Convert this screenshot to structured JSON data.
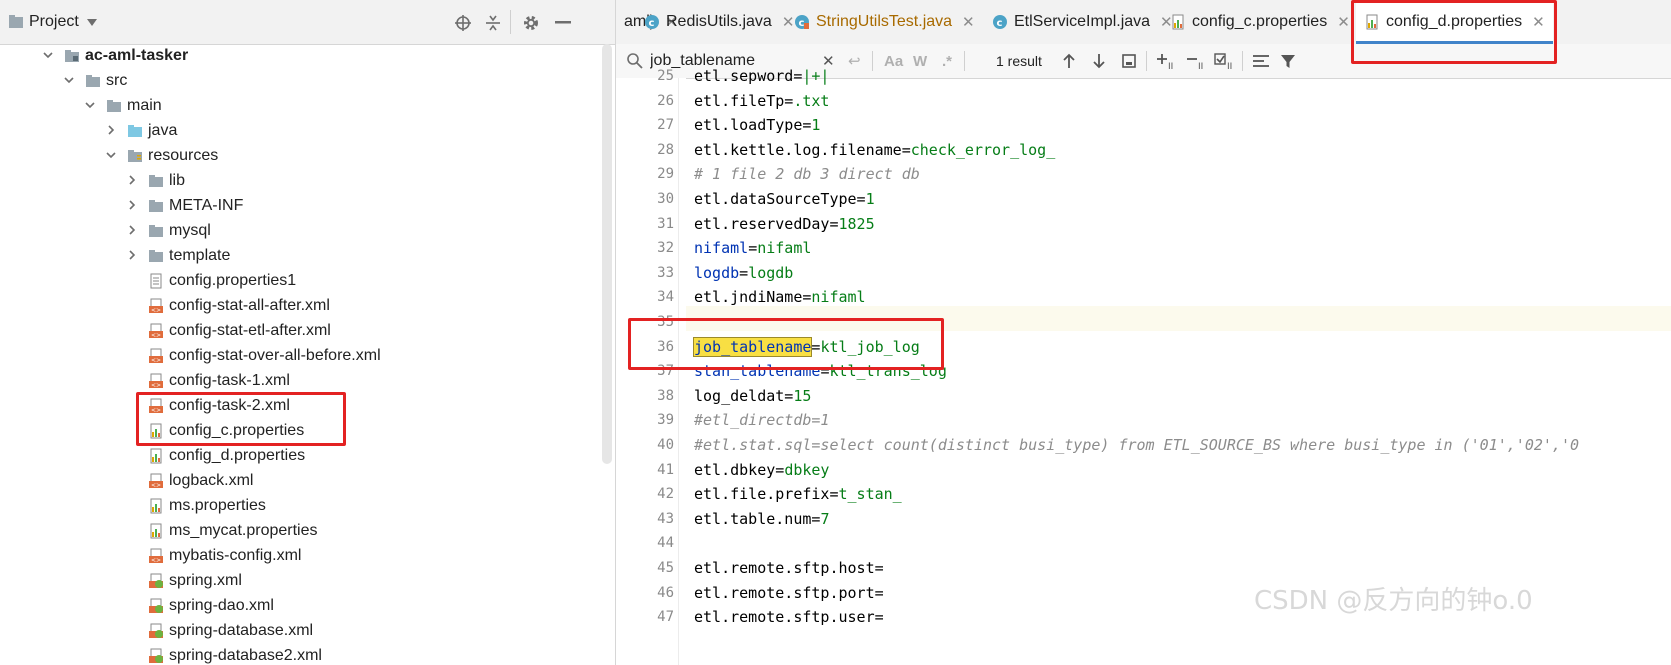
{
  "project": {
    "title": "Project",
    "tree": [
      {
        "label": "ac-aml-tasker",
        "type": "module",
        "depth": 0,
        "expanded": true,
        "bold": true
      },
      {
        "label": "src",
        "type": "folder",
        "depth": 1,
        "expanded": true
      },
      {
        "label": "main",
        "type": "folder",
        "depth": 2,
        "expanded": true
      },
      {
        "label": "java",
        "type": "src-folder",
        "depth": 3,
        "expanded": false
      },
      {
        "label": "resources",
        "type": "res-folder",
        "depth": 3,
        "expanded": true
      },
      {
        "label": "lib",
        "type": "folder",
        "depth": 4,
        "expanded": false
      },
      {
        "label": "META-INF",
        "type": "folder",
        "depth": 4,
        "expanded": false
      },
      {
        "label": "mysql",
        "type": "folder",
        "depth": 4,
        "expanded": false
      },
      {
        "label": "template",
        "type": "folder",
        "depth": 4,
        "expanded": false
      },
      {
        "label": "config.properties1",
        "type": "text-file",
        "depth": 4
      },
      {
        "label": "config-stat-all-after.xml",
        "type": "xml-file",
        "depth": 4
      },
      {
        "label": "config-stat-etl-after.xml",
        "type": "xml-file",
        "depth": 4
      },
      {
        "label": "config-stat-over-all-before.xml",
        "type": "xml-file",
        "depth": 4
      },
      {
        "label": "config-task-1.xml",
        "type": "xml-file",
        "depth": 4
      },
      {
        "label": "config-task-2.xml",
        "type": "xml-file",
        "depth": 4
      },
      {
        "label": "config_c.properties",
        "type": "properties-file",
        "depth": 4
      },
      {
        "label": "config_d.properties",
        "type": "properties-file",
        "depth": 4
      },
      {
        "label": "logback.xml",
        "type": "xml-file",
        "depth": 4
      },
      {
        "label": "ms.properties",
        "type": "properties-file",
        "depth": 4
      },
      {
        "label": "ms_mycat.properties",
        "type": "properties-file",
        "depth": 4
      },
      {
        "label": "mybatis-config.xml",
        "type": "xml-file",
        "depth": 4
      },
      {
        "label": "spring.xml",
        "type": "spring-file",
        "depth": 4
      },
      {
        "label": "spring-dao.xml",
        "type": "spring-file",
        "depth": 4
      },
      {
        "label": "spring-database.xml",
        "type": "spring-file",
        "depth": 4
      },
      {
        "label": "spring-database2.xml",
        "type": "spring-file",
        "depth": 4
      }
    ]
  },
  "tabs": [
    {
      "label": "aml)",
      "icon": "none",
      "active": false
    },
    {
      "label": "RedisUtils.java",
      "icon": "class-icon",
      "active": false
    },
    {
      "label": "StringUtilsTest.java",
      "icon": "test-class-icon",
      "active": false,
      "color": "#a86a00"
    },
    {
      "label": "EtlServiceImpl.java",
      "icon": "class-icon",
      "active": false
    },
    {
      "label": "config_c.properties",
      "icon": "properties-icon",
      "active": false
    },
    {
      "label": "config_d.properties",
      "icon": "properties-icon",
      "active": true
    }
  ],
  "search": {
    "query": "job_tablename",
    "result_count": "1 result",
    "match_case": "Aa",
    "words": "W",
    "regex": ".*"
  },
  "code": [
    {
      "n": "25",
      "t": "etl.sepword=|+|"
    },
    {
      "n": "26",
      "t": "etl.fileTp=.txt"
    },
    {
      "n": "27",
      "t": "etl.loadType=1"
    },
    {
      "n": "28",
      "t": "etl.kettle.log.filename=check_error_log_"
    },
    {
      "n": "29",
      "t": "# 1 file 2 db 3 direct db"
    },
    {
      "n": "30",
      "t": "etl.dataSourceType=1"
    },
    {
      "n": "31",
      "t": "etl.reservedDay=1825"
    },
    {
      "n": "32",
      "t": "nifaml=nifaml"
    },
    {
      "n": "33",
      "t": "logdb=logdb"
    },
    {
      "n": "34",
      "t": "etl.jndiName=nifaml"
    },
    {
      "n": "35",
      "t": ""
    },
    {
      "n": "36",
      "t": "job_tablename=ktl_job_log"
    },
    {
      "n": "37",
      "t": "stan_tablename=ktl_trans_log"
    },
    {
      "n": "38",
      "t": "log_deldat=15"
    },
    {
      "n": "39",
      "t": "#etl_directdb=1"
    },
    {
      "n": "40",
      "t": "#etl.stat.sql=select count(distinct busi_type) from ETL_SOURCE_BS where busi_type in ('01','02','0"
    },
    {
      "n": "41",
      "t": "etl.dbkey=dbkey"
    },
    {
      "n": "42",
      "t": "etl.file.prefix=t_stan_"
    },
    {
      "n": "43",
      "t": "etl.table.num=7"
    },
    {
      "n": "44",
      "t": ""
    },
    {
      "n": "45",
      "t": "etl.remote.sftp.host="
    },
    {
      "n": "46",
      "t": "etl.remote.sftp.port="
    },
    {
      "n": "47",
      "t": "etl.remote.sftp.user="
    }
  ],
  "watermark": "CSDN @反方向的钟o.0",
  "colors": {
    "highlight_box": "#e32222",
    "search_match": "#f8df43",
    "key": "#0033b3",
    "value": "#067d17",
    "comment": "#8c8c8c"
  }
}
